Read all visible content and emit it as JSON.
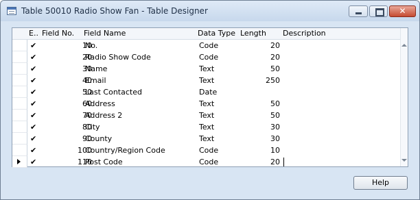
{
  "window": {
    "title": "Table 50010 Radio Show Fan - Table Designer"
  },
  "columns": {
    "enabled": "E..",
    "field_no": "Field No.",
    "field_name": "Field Name",
    "data_type": "Data Type",
    "length": "Length",
    "description": "Description"
  },
  "rows": [
    {
      "enabled": "✔",
      "field_no": "10",
      "field_name": "No.",
      "data_type": "Code",
      "length": "20",
      "description": ""
    },
    {
      "enabled": "✔",
      "field_no": "20",
      "field_name": "Radio Show Code",
      "data_type": "Code",
      "length": "20",
      "description": ""
    },
    {
      "enabled": "✔",
      "field_no": "30",
      "field_name": "Name",
      "data_type": "Text",
      "length": "50",
      "description": ""
    },
    {
      "enabled": "✔",
      "field_no": "40",
      "field_name": "Email",
      "data_type": "Text",
      "length": "250",
      "description": ""
    },
    {
      "enabled": "✔",
      "field_no": "50",
      "field_name": "Last Contacted",
      "data_type": "Date",
      "length": "",
      "description": ""
    },
    {
      "enabled": "✔",
      "field_no": "60",
      "field_name": "Address",
      "data_type": "Text",
      "length": "50",
      "description": ""
    },
    {
      "enabled": "✔",
      "field_no": "70",
      "field_name": "Address 2",
      "data_type": "Text",
      "length": "50",
      "description": ""
    },
    {
      "enabled": "✔",
      "field_no": "80",
      "field_name": "City",
      "data_type": "Text",
      "length": "30",
      "description": ""
    },
    {
      "enabled": "✔",
      "field_no": "90",
      "field_name": "County",
      "data_type": "Text",
      "length": "30",
      "description": ""
    },
    {
      "enabled": "✔",
      "field_no": "100",
      "field_name": "Country/Region Code",
      "data_type": "Code",
      "length": "10",
      "description": ""
    },
    {
      "enabled": "✔",
      "field_no": "110",
      "field_name": "Post Code",
      "data_type": "Code",
      "length": "20",
      "description": ""
    }
  ],
  "current_row_index": 10,
  "buttons": {
    "help": "Help"
  },
  "icons": {
    "app": "table-designer-icon",
    "minimize": "minimize-icon",
    "maximize": "maximize-icon",
    "close": "close-icon",
    "row_pointer": "row-pointer-icon",
    "scroll_up": "scroll-up-icon",
    "scroll_down": "scroll-down-icon"
  },
  "colors": {
    "window_bg": "#d8e5f3",
    "close_button": "#c54a31"
  }
}
